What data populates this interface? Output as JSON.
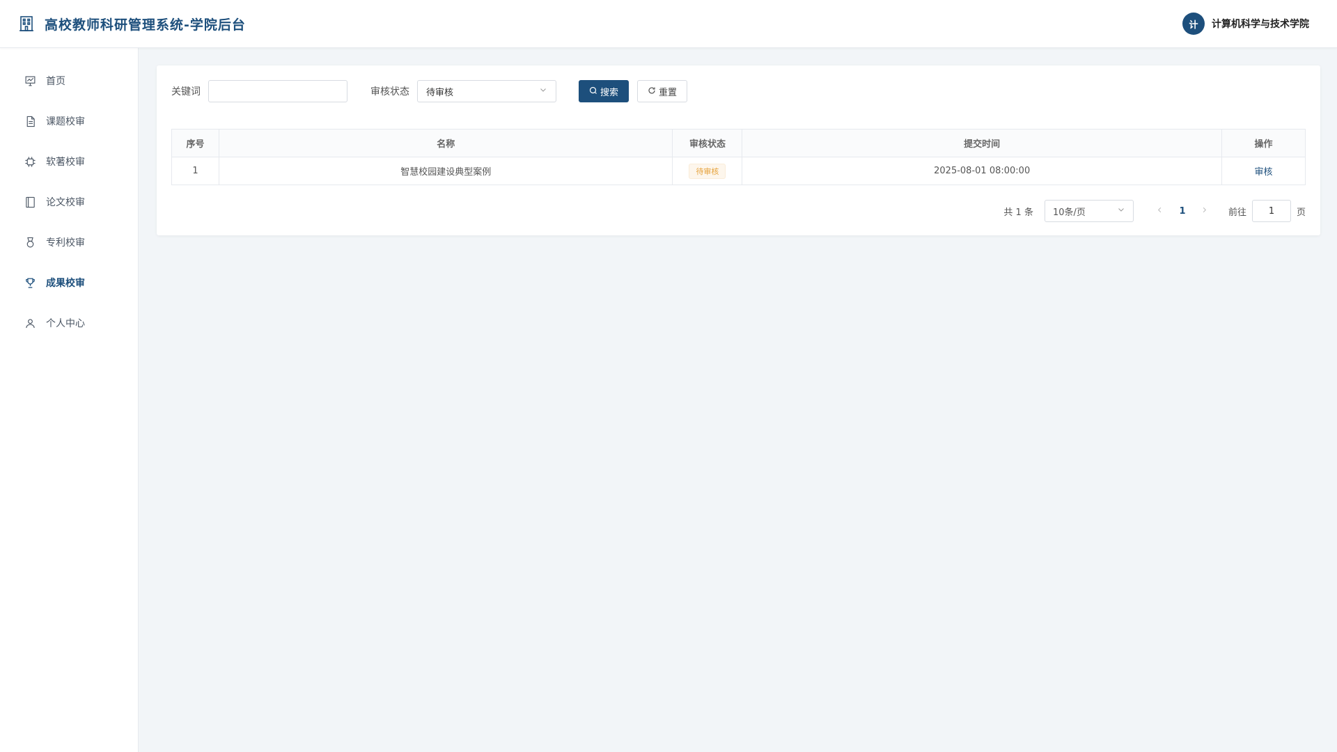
{
  "header": {
    "title": "高校教师科研管理系统-学院后台",
    "brand_icon": "building-icon",
    "avatar_text": "计",
    "user_name": "计算机科学与技术学院"
  },
  "sidebar": {
    "items": [
      {
        "label": "首页",
        "icon": "dashboard-icon",
        "active": false
      },
      {
        "label": "课题校审",
        "icon": "document-icon",
        "active": false
      },
      {
        "label": "软著校审",
        "icon": "chip-icon",
        "active": false
      },
      {
        "label": "论文校审",
        "icon": "notebook-icon",
        "active": false
      },
      {
        "label": "专利校审",
        "icon": "medal-icon",
        "active": false
      },
      {
        "label": "成果校审",
        "icon": "trophy-icon",
        "active": true
      },
      {
        "label": "个人中心",
        "icon": "user-icon",
        "active": false
      }
    ]
  },
  "filter": {
    "keyword_label": "关键词",
    "keyword_value": "",
    "keyword_placeholder": "",
    "status_label": "审核状态",
    "status_value": "待审核",
    "search_label": "搜索",
    "reset_label": "重置"
  },
  "table": {
    "columns": [
      "序号",
      "名称",
      "审核状态",
      "提交时间",
      "操作"
    ],
    "rows": [
      {
        "index": "1",
        "name": "智慧校园建设典型案例",
        "status": "待审核",
        "submitted": "2025-08-01 08:00:00",
        "action": "审核"
      }
    ]
  },
  "pagination": {
    "total": "共 1 条",
    "page_size": "10条/页",
    "current_page": "1",
    "goto_label": "前往",
    "goto_value": "1",
    "page_suffix": "页"
  },
  "colors": {
    "primary": "#1d4f7c",
    "warning": "#e6a23c",
    "background": "#f2f5f8"
  }
}
